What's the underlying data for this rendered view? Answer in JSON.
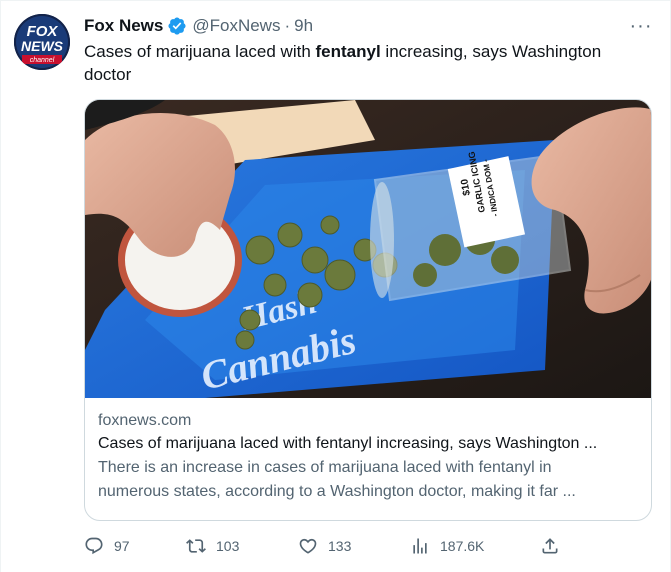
{
  "author": {
    "name": "Fox News",
    "handle": "@FoxNews",
    "separator": "·",
    "time": "9h",
    "verified": true,
    "avatar_logo": {
      "line1": "FOX",
      "line2": "NEWS",
      "line3": "channel"
    }
  },
  "more_icon": "···",
  "tweet": {
    "text_before": "Cases of marijuana laced with ",
    "text_bold": "fentanyl",
    "text_after": " increasing, says Washington doctor"
  },
  "card": {
    "image_text": {
      "tray_brand_1": "Hash",
      "tray_brand_2": "Cannabis",
      "jar_label_1": "$10",
      "jar_label_2": "GARLIC ICING",
      "jar_label_3": "- INDICA DOM -"
    },
    "domain": "foxnews.com",
    "title": "Cases of marijuana laced with fentanyl increasing, says Washington ...",
    "description_line1": "There is an increase in cases of marijuana laced with fentanyl in",
    "description_line2": "numerous states, according to a Washington doctor, making it far ..."
  },
  "actions": {
    "replies": "97",
    "retweets": "103",
    "likes": "133",
    "views": "187.6K"
  },
  "colors": {
    "text": "#0f1419",
    "secondary": "#536471",
    "verified": "#1d9bf0",
    "border": "#cfd9de"
  }
}
